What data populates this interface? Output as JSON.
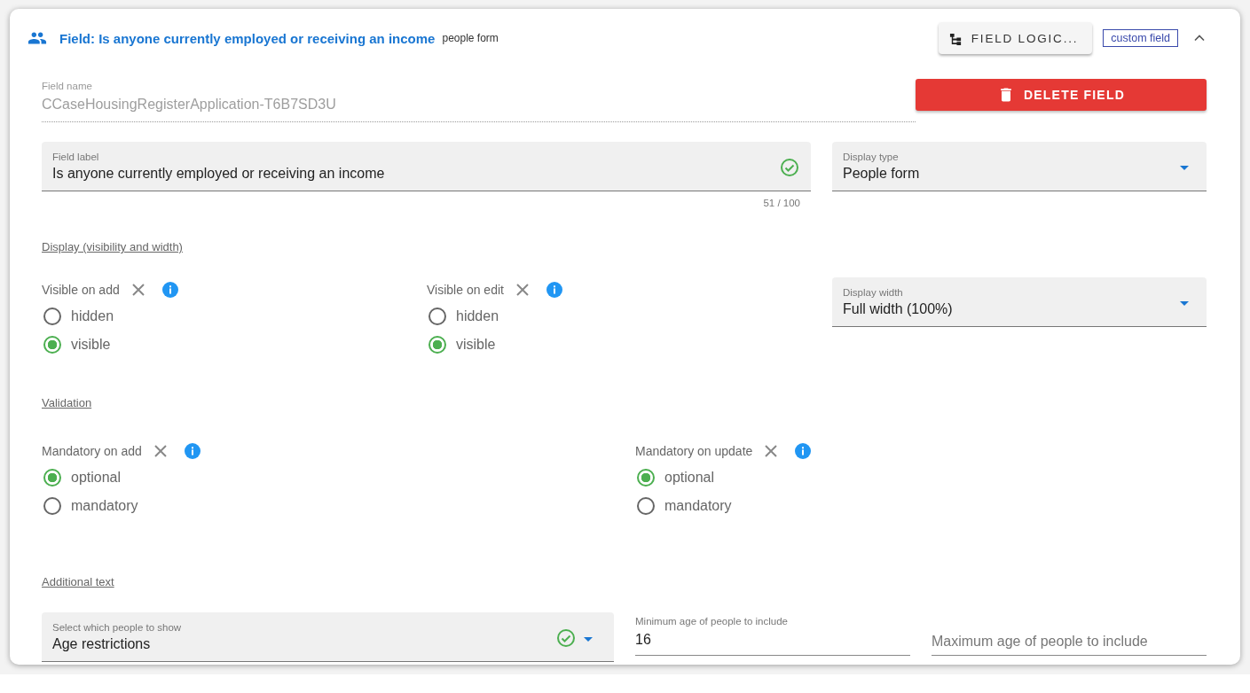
{
  "header": {
    "title": "Field: Is anyone currently employed or receiving an income",
    "subtitle": "people form",
    "logic_button": "FIELD LOGIC...",
    "tag": "custom field",
    "expanded": true
  },
  "field_name": {
    "label": "Field name",
    "value": "CCaseHousingRegisterApplication-T6B7SD3U"
  },
  "delete_button": "DELETE FIELD",
  "field_label": {
    "label": "Field label",
    "value": "Is anyone currently employed or receiving an income",
    "valid": true,
    "counter": "51 / 100"
  },
  "display_type": {
    "label": "Display type",
    "value": "People form"
  },
  "display_section": {
    "heading": "Display (visibility and width)",
    "groups": [
      {
        "label": "Visible on add",
        "options": [
          {
            "label": "hidden",
            "selected": false
          },
          {
            "label": "visible",
            "selected": true
          }
        ]
      },
      {
        "label": "Visible on edit",
        "options": [
          {
            "label": "hidden",
            "selected": false
          },
          {
            "label": "visible",
            "selected": true
          }
        ]
      }
    ],
    "display_width": {
      "label": "Display width",
      "value": "Full width (100%)"
    }
  },
  "validation_section": {
    "heading": "Validation",
    "groups": [
      {
        "label": "Mandatory on add",
        "options": [
          {
            "label": "optional",
            "selected": true
          },
          {
            "label": "mandatory",
            "selected": false
          }
        ]
      },
      {
        "label": "Mandatory on update",
        "options": [
          {
            "label": "optional",
            "selected": true
          },
          {
            "label": "mandatory",
            "selected": false
          }
        ]
      }
    ]
  },
  "additional_section": {
    "heading": "Additional text",
    "people_select": {
      "label": "Select which people to show",
      "value": "Age restrictions",
      "valid": true
    },
    "min_age": {
      "label": "Minimum age of people to include",
      "value": "16"
    },
    "max_age": {
      "placeholder": "Maximum age of people to include"
    }
  }
}
